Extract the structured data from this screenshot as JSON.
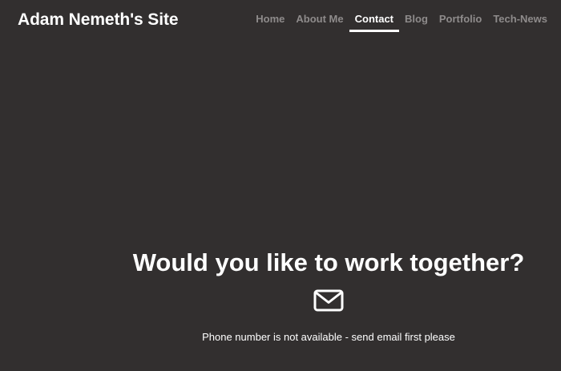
{
  "header": {
    "site_title": "Adam Nemeth's Site"
  },
  "nav": {
    "items": [
      {
        "label": "Home",
        "active": false
      },
      {
        "label": "About Me",
        "active": false
      },
      {
        "label": "Contact",
        "active": true
      },
      {
        "label": "Blog",
        "active": false
      },
      {
        "label": "Portfolio",
        "active": false
      },
      {
        "label": "Tech-News",
        "active": false
      }
    ]
  },
  "contact": {
    "headline": "Would you like to work together?",
    "icon": "envelope-icon",
    "note": "Phone number is not available - send email first please"
  },
  "colors": {
    "background": "#322f2f",
    "nav_inactive": "#8e8b8b",
    "text": "#ffffff"
  }
}
